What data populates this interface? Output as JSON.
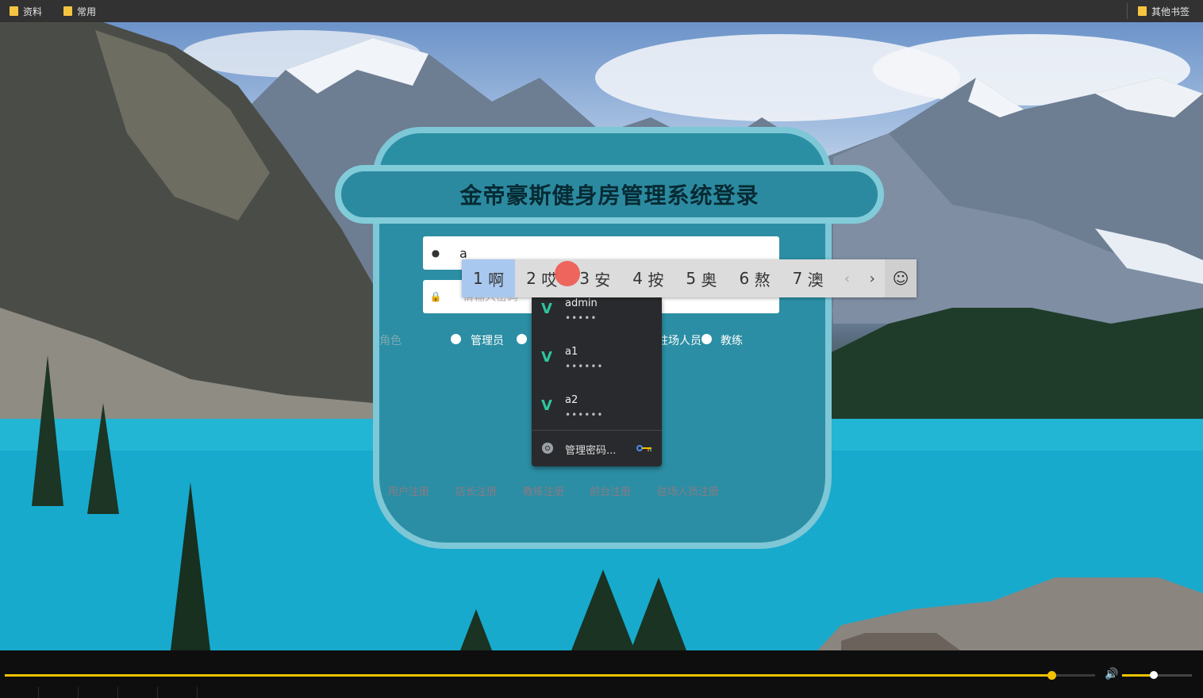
{
  "bookmarks": {
    "left": [
      {
        "label": "资料",
        "icon": "folder-icon"
      },
      {
        "label": "常用",
        "icon": "folder-icon"
      }
    ],
    "right": {
      "label": "其他书签",
      "icon": "folder-icon"
    }
  },
  "login": {
    "title": "金帝豪斯健身房管理系统登录",
    "username_value": "a",
    "password_placeholder": "请输入密码",
    "role_label": "角色",
    "roles": [
      "管理员",
      "驻场人员",
      "教练"
    ],
    "register_links": [
      "用户注册",
      "店长注册",
      "教练注册",
      "前台注册",
      "驻场人员注册"
    ]
  },
  "ime": {
    "candidates": [
      {
        "num": "1",
        "char": "啊"
      },
      {
        "num": "2",
        "char": "哎"
      },
      {
        "num": "3",
        "char": "安"
      },
      {
        "num": "4",
        "char": "按"
      },
      {
        "num": "5",
        "char": "奥"
      },
      {
        "num": "6",
        "char": "熬"
      },
      {
        "num": "7",
        "char": "澳"
      }
    ],
    "prev": "‹",
    "next": "›",
    "emoji": "☺"
  },
  "autofill": {
    "entries": [
      {
        "username": "admin",
        "password_mask": "•••••"
      },
      {
        "username": "a1",
        "password_mask": "••••••"
      },
      {
        "username": "a2",
        "password_mask": "••••••"
      }
    ],
    "manage_label": "管理密码..."
  },
  "player": {
    "progress": 0.96,
    "volume": 0.45
  },
  "colors": {
    "panel": "#2b8ea4",
    "panel_border": "#7ec7d6",
    "accent": "#f2c200"
  }
}
